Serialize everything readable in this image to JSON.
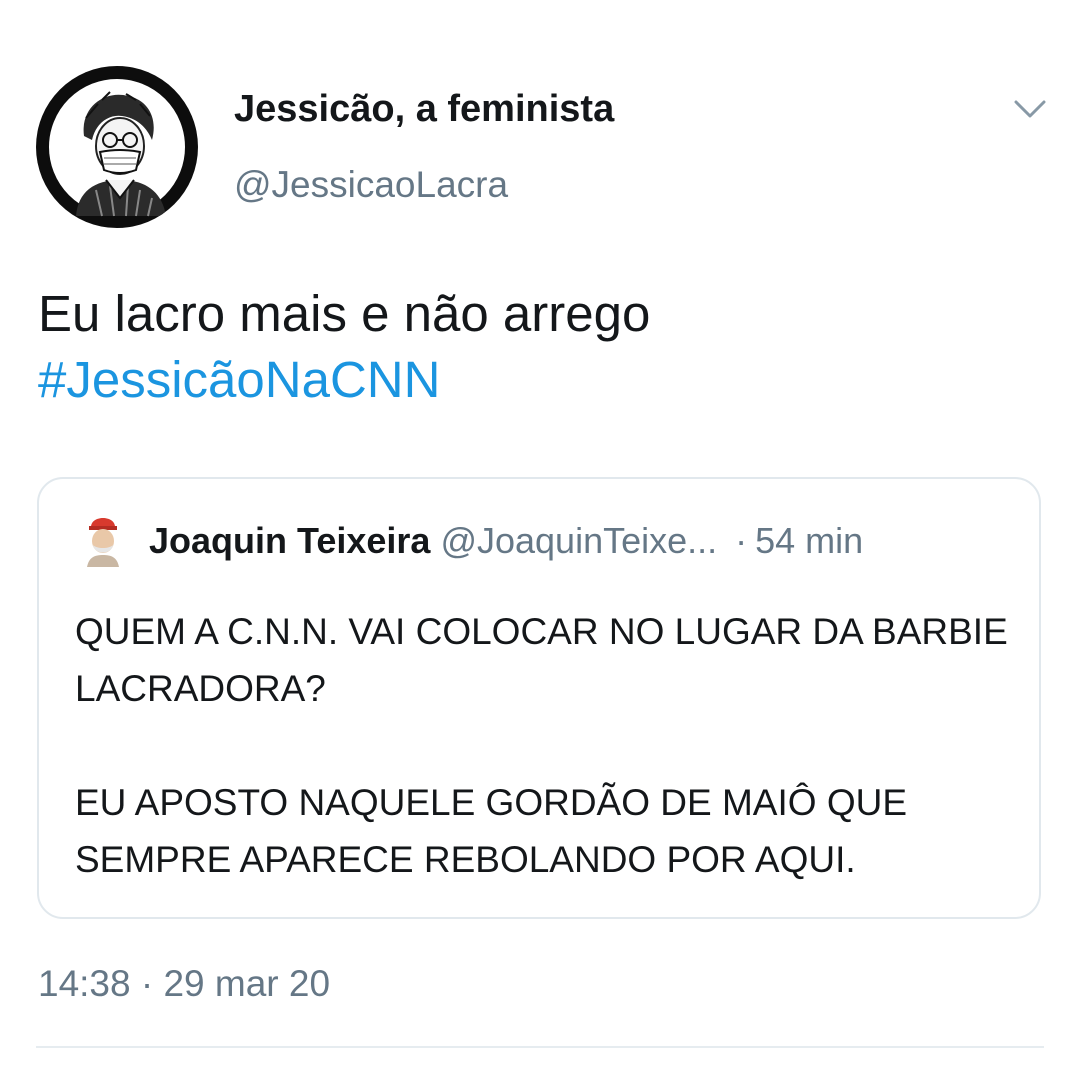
{
  "tweet": {
    "author": {
      "display_name": "Jessicão, a feminista",
      "handle": "@JessicaoLacra",
      "avatar_icon": "sketch-portrait-avatar"
    },
    "menu_icon": "chevron-down-icon",
    "text": "Eu lacro mais e não arrego",
    "hashtag": "#JessicãoNaCNN",
    "timestamp": "14:38 · 29 mar 20"
  },
  "quoted_tweet": {
    "author": {
      "display_name": "Joaquin Teixeira",
      "handle": "@JoaquinTeixe...",
      "avatar_icon": "red-cap-avatar"
    },
    "separator": "·",
    "relative_time": "54 min",
    "paragraphs": [
      "QUEM A C.N.N. VAI COLOCAR NO LUGAR DA BARBIE LACRADORA?",
      "EU APOSTO NAQUELE GORDÃO DE MAIÔ QUE SEMPRE APARECE REBOLANDO POR AQUI."
    ]
  },
  "colors": {
    "text_primary": "#14171a",
    "text_secondary": "#657786",
    "link": "#1b95e0",
    "border": "#e1e8ed"
  }
}
